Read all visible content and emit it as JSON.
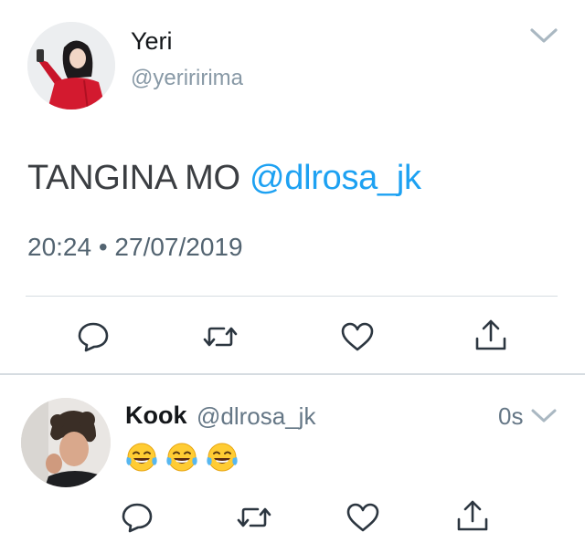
{
  "main_tweet": {
    "author_name": "Yeri",
    "author_handle": "@yeriririma",
    "text_plain": "TANGINA MO ",
    "text_mention": "@dlrosa_jk",
    "timestamp": "20:24 • 27/07/2019",
    "actions": [
      "reply-icon",
      "retweet-icon",
      "like-icon",
      "share-icon"
    ]
  },
  "reply_tweet": {
    "author_name": "Kook",
    "author_handle": "@dlrosa_jk",
    "relative_time": "0s",
    "emojis": [
      "😂",
      "😂",
      "😂"
    ],
    "actions": [
      "reply-icon",
      "retweet-icon",
      "like-icon",
      "share-icon"
    ]
  },
  "colors": {
    "mention": "#1da1f2",
    "icon_gray": "#8899a6",
    "text_dark": "#14171a",
    "meta_gray": "#536471",
    "divider": "#d6dce1"
  }
}
